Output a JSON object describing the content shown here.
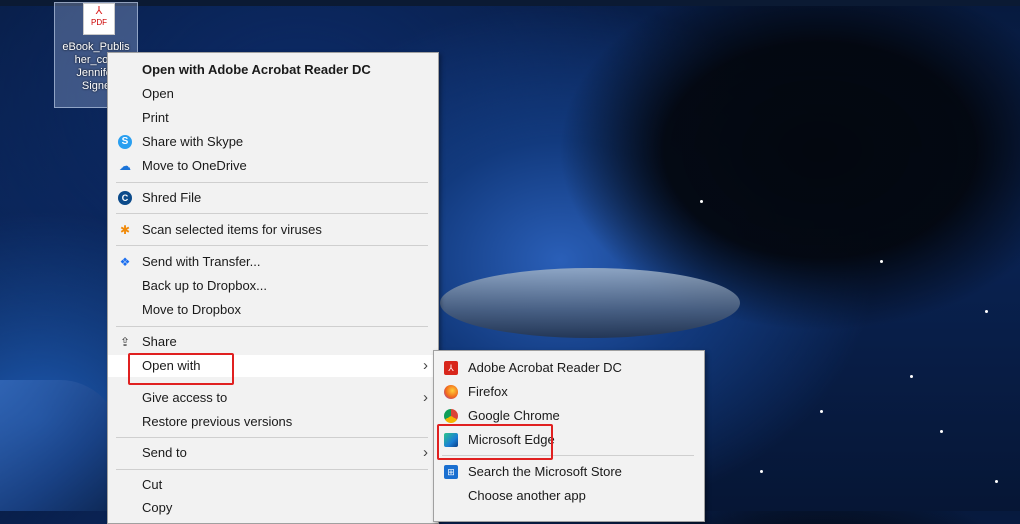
{
  "desktop": {
    "file_icon_label": "PDF",
    "file_name_lines": [
      "eBook_Publis",
      "her_cont",
      "Jennifer",
      "Signe"
    ]
  },
  "context_menu": {
    "items": [
      {
        "label": "Open with Adobe Acrobat Reader DC",
        "icon": ""
      },
      {
        "label": "Open",
        "icon": ""
      },
      {
        "label": "Print",
        "icon": ""
      },
      {
        "label": "Share with Skype",
        "icon": "skype-icon"
      },
      {
        "label": "Move to OneDrive",
        "icon": "onedrive-icon"
      },
      {
        "label": "Shred File",
        "icon": "shred-icon"
      },
      {
        "label": "Scan selected items for viruses",
        "icon": "antivirus-icon"
      },
      {
        "label": "Send with Transfer...",
        "icon": "dropbox-icon"
      },
      {
        "label": "Back up to Dropbox...",
        "icon": ""
      },
      {
        "label": "Move to Dropbox",
        "icon": ""
      },
      {
        "label": "Share",
        "icon": "share-icon"
      },
      {
        "label": "Open with",
        "icon": ""
      },
      {
        "label": "Give access to",
        "icon": ""
      },
      {
        "label": "Restore previous versions",
        "icon": ""
      },
      {
        "label": "Send to",
        "icon": ""
      },
      {
        "label": "Cut",
        "icon": ""
      },
      {
        "label": "Copy",
        "icon": ""
      }
    ]
  },
  "open_with_submenu": {
    "items": [
      {
        "label": "Adobe Acrobat Reader DC",
        "icon": "acrobat-icon"
      },
      {
        "label": "Firefox",
        "icon": "firefox-icon"
      },
      {
        "label": "Google Chrome",
        "icon": "chrome-icon"
      },
      {
        "label": "Microsoft Edge",
        "icon": "edge-icon"
      },
      {
        "label": "Search the Microsoft Store",
        "icon": "store-icon"
      },
      {
        "label": "Choose another app",
        "icon": ""
      }
    ]
  },
  "colors": {
    "highlight_box": "#e02020",
    "menu_background": "#f2f2f2"
  }
}
